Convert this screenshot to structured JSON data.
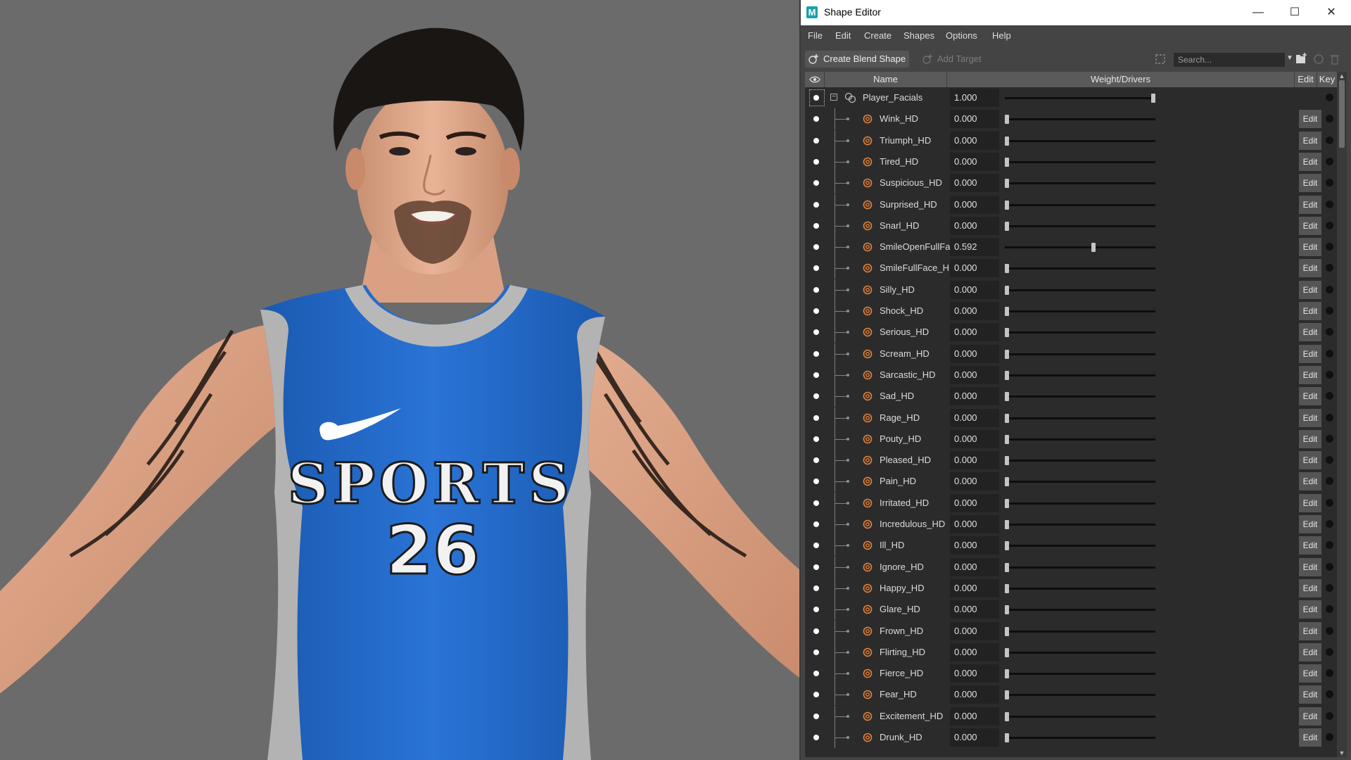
{
  "viewport": {
    "jersey_text": "SPORTS",
    "jersey_number": "26",
    "jersey_color": "#1f67c6",
    "trim_color": "#b9b9b9",
    "background_color": "#6b6b6b"
  },
  "window": {
    "title": "Shape Editor",
    "app_icon_letter": "M",
    "controls": [
      "minimize-icon",
      "maximize-icon",
      "close-icon"
    ]
  },
  "menu": [
    "File",
    "Edit",
    "Create",
    "Shapes",
    "Options",
    "Help"
  ],
  "toolbar": {
    "create_blend_shape": "Create Blend Shape",
    "add_target": "Add Target",
    "search_placeholder": "Search..."
  },
  "columns": {
    "name": "Name",
    "weight": "Weight/Drivers",
    "edit": "Edit",
    "key": "Key"
  },
  "blend_shape": {
    "name": "Player_Facials",
    "weight": "1.000",
    "slider": 1.0
  },
  "targets": [
    {
      "name": "Wink_HD",
      "weight": "0.000",
      "slider": 0.0
    },
    {
      "name": "Triumph_HD",
      "weight": "0.000",
      "slider": 0.0
    },
    {
      "name": "Tired_HD",
      "weight": "0.000",
      "slider": 0.0
    },
    {
      "name": "Suspicious_HD",
      "weight": "0.000",
      "slider": 0.0
    },
    {
      "name": "Surprised_HD",
      "weight": "0.000",
      "slider": 0.0
    },
    {
      "name": "Snarl_HD",
      "weight": "0.000",
      "slider": 0.0
    },
    {
      "name": "SmileOpenFullFa",
      "weight": "0.592",
      "slider": 0.592
    },
    {
      "name": "SmileFullFace_H",
      "weight": "0.000",
      "slider": 0.0
    },
    {
      "name": "Silly_HD",
      "weight": "0.000",
      "slider": 0.0
    },
    {
      "name": "Shock_HD",
      "weight": "0.000",
      "slider": 0.0
    },
    {
      "name": "Serious_HD",
      "weight": "0.000",
      "slider": 0.0
    },
    {
      "name": "Scream_HD",
      "weight": "0.000",
      "slider": 0.0
    },
    {
      "name": "Sarcastic_HD",
      "weight": "0.000",
      "slider": 0.0
    },
    {
      "name": "Sad_HD",
      "weight": "0.000",
      "slider": 0.0
    },
    {
      "name": "Rage_HD",
      "weight": "0.000",
      "slider": 0.0
    },
    {
      "name": "Pouty_HD",
      "weight": "0.000",
      "slider": 0.0
    },
    {
      "name": "Pleased_HD",
      "weight": "0.000",
      "slider": 0.0
    },
    {
      "name": "Pain_HD",
      "weight": "0.000",
      "slider": 0.0
    },
    {
      "name": "Irritated_HD",
      "weight": "0.000",
      "slider": 0.0
    },
    {
      "name": "Incredulous_HD",
      "weight": "0.000",
      "slider": 0.0
    },
    {
      "name": "Ill_HD",
      "weight": "0.000",
      "slider": 0.0
    },
    {
      "name": "Ignore_HD",
      "weight": "0.000",
      "slider": 0.0
    },
    {
      "name": "Happy_HD",
      "weight": "0.000",
      "slider": 0.0
    },
    {
      "name": "Glare_HD",
      "weight": "0.000",
      "slider": 0.0
    },
    {
      "name": "Frown_HD",
      "weight": "0.000",
      "slider": 0.0
    },
    {
      "name": "Flirting_HD",
      "weight": "0.000",
      "slider": 0.0
    },
    {
      "name": "Fierce_HD",
      "weight": "0.000",
      "slider": 0.0
    },
    {
      "name": "Fear_HD",
      "weight": "0.000",
      "slider": 0.0
    },
    {
      "name": "Excitement_HD",
      "weight": "0.000",
      "slider": 0.0
    },
    {
      "name": "Drunk_HD",
      "weight": "0.000",
      "slider": 0.0
    }
  ],
  "edit_label": "Edit",
  "colors": {
    "panel": "#444444",
    "list_bg": "#2b2b2b",
    "target_icon": "#e8833a",
    "title_bar": "#ffffff"
  }
}
